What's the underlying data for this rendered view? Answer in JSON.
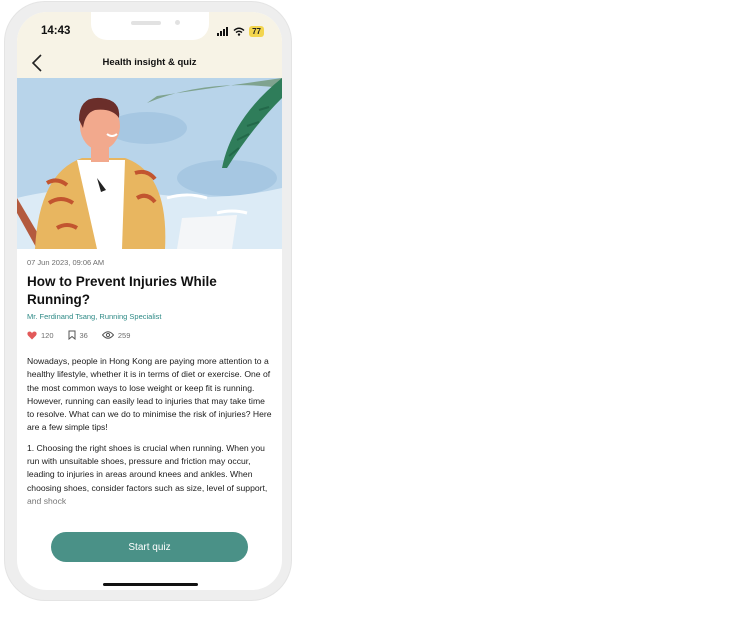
{
  "status_bar": {
    "time": "14:43",
    "battery": "77"
  },
  "header": {
    "title": "Health insight & quiz"
  },
  "article": {
    "date": "07 Jun 2023, 09:06 AM",
    "title": "How to Prevent Injuries While Running?",
    "author": "Mr. Ferdinand Tsang, Running Specialist",
    "likes": "120",
    "bookmarks": "36",
    "views": "259",
    "paragraph1": "Nowadays, people in Hong Kong are paying more attention to a healthy lifestyle, whether it is in terms of diet or exercise. One of the most common ways to lose weight or keep fit is running. However, running can easily lead to injuries that may take time to resolve. What can we do to minimise the risk of injuries? Here are a few simple tips!",
    "paragraph2": "1. Choosing the right shoes is crucial when running. When you run with unsuitable shoes, pressure and friction may occur, leading to injuries in areas around knees and ankles. When choosing shoes, consider factors such as size, level of support, and shock"
  },
  "actions": {
    "start_quiz": "Start quiz"
  },
  "colors": {
    "accent": "#4a9187",
    "header_bg": "#f7f3e6",
    "link": "#2e8a86",
    "like": "#e25a5a"
  }
}
